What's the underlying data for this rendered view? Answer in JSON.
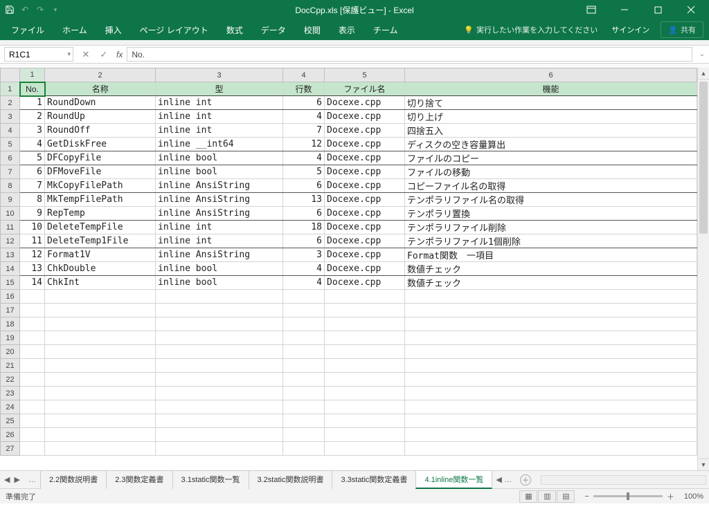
{
  "title": "DocCpp.xls  [保護ビュー] - Excel",
  "ribbon": [
    "ファイル",
    "ホーム",
    "挿入",
    "ページ レイアウト",
    "数式",
    "データ",
    "校閲",
    "表示",
    "チーム"
  ],
  "tellme": "実行したい作業を入力してください",
  "signin": "サインイン",
  "share": "共有",
  "namebox": "R1C1",
  "formula": "No.",
  "col_nums": [
    "1",
    "2",
    "3",
    "4",
    "5",
    "6"
  ],
  "headers": [
    "No.",
    "名称",
    "型",
    "行数",
    "ファイル名",
    "機能"
  ],
  "rows": [
    {
      "n": "1",
      "name": "RoundDown",
      "type": "inline int",
      "lines": "6",
      "file": "Docexe.cpp",
      "func": "切り捨て",
      "u": true
    },
    {
      "n": "2",
      "name": "RoundUp",
      "type": "inline int",
      "lines": "4",
      "file": "Docexe.cpp",
      "func": "切り上げ"
    },
    {
      "n": "3",
      "name": "RoundOff",
      "type": "inline int",
      "lines": "7",
      "file": "Docexe.cpp",
      "func": "四捨五入"
    },
    {
      "n": "4",
      "name": "GetDiskFree",
      "type": "inline __int64",
      "lines": "12",
      "file": "Docexe.cpp",
      "func": "ディスクの空き容量算出",
      "u": true
    },
    {
      "n": "5",
      "name": "DFCopyFile",
      "type": "inline bool",
      "lines": "4",
      "file": "Docexe.cpp",
      "func": "ファイルのコピー",
      "u": true
    },
    {
      "n": "6",
      "name": "DFMoveFile",
      "type": "inline bool",
      "lines": "5",
      "file": "Docexe.cpp",
      "func": "ファイルの移動"
    },
    {
      "n": "7",
      "name": "MkCopyFilePath",
      "type": "inline AnsiString",
      "lines": "6",
      "file": "Docexe.cpp",
      "func": "コピーファイル名の取得",
      "u": true
    },
    {
      "n": "8",
      "name": "MkTempFilePath",
      "type": "inline AnsiString",
      "lines": "13",
      "file": "Docexe.cpp",
      "func": "テンポラリファイル名の取得"
    },
    {
      "n": "9",
      "name": "RepTemp",
      "type": "inline AnsiString",
      "lines": "6",
      "file": "Docexe.cpp",
      "func": "テンポラリ置換",
      "u": true
    },
    {
      "n": "10",
      "name": "DeleteTempFile",
      "type": "inline int",
      "lines": "18",
      "file": "Docexe.cpp",
      "func": "テンポラリファイル削除"
    },
    {
      "n": "11",
      "name": "DeleteTemp1File",
      "type": "inline int",
      "lines": "6",
      "file": "Docexe.cpp",
      "func": "テンポラリファイル1個削除",
      "u": true
    },
    {
      "n": "12",
      "name": "Format1V",
      "type": "inline AnsiString",
      "lines": "3",
      "file": "Docexe.cpp",
      "func": "Format関数　一項目"
    },
    {
      "n": "13",
      "name": "ChkDouble",
      "type": "inline bool",
      "lines": "4",
      "file": "Docexe.cpp",
      "func": "数値チェック",
      "u": true
    },
    {
      "n": "14",
      "name": "ChkInt",
      "type": "inline bool",
      "lines": "4",
      "file": "Docexe.cpp",
      "func": "数値チェック"
    }
  ],
  "empty_rows": 12,
  "sheet_tabs": [
    "2.2関数説明書",
    "2.3関数定義書",
    "3.1static関数一覧",
    "3.2static関数説明書",
    "3.3static関数定義書",
    "4.1inline関数一覧"
  ],
  "active_tab": 5,
  "status": "準備完了",
  "zoom": "100%"
}
